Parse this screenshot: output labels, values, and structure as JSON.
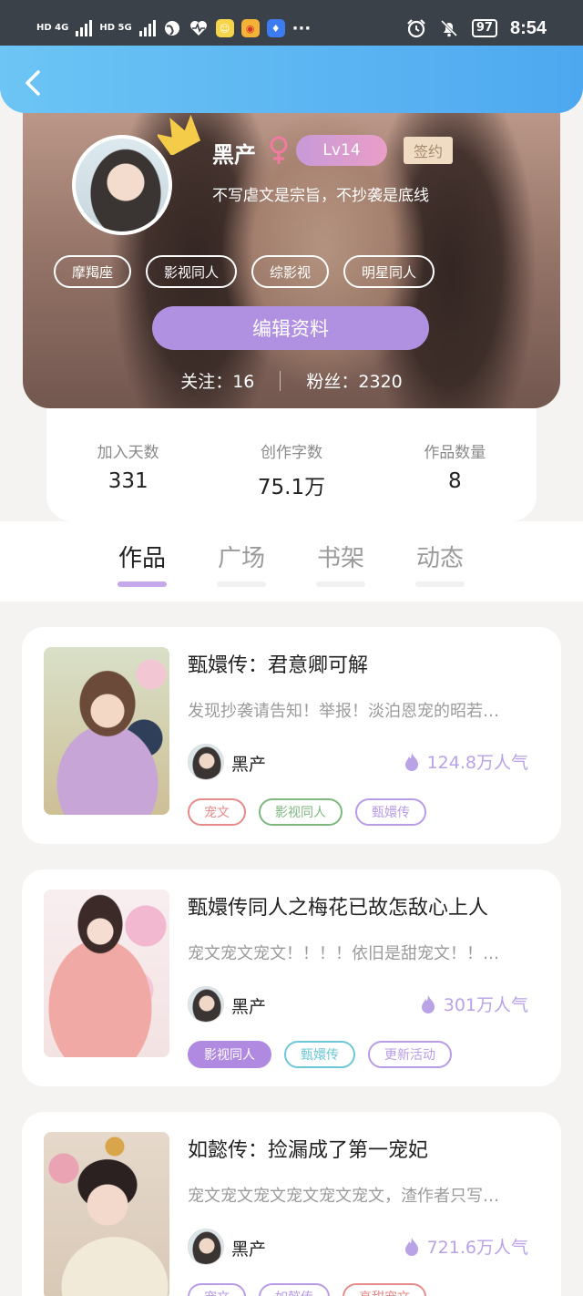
{
  "status_bar": {
    "network_1": "HD 4G",
    "network_2": "HD 5G",
    "battery": "97",
    "time": "8:54",
    "dots": "···"
  },
  "profile": {
    "username": "黑产",
    "level": "Lv14",
    "sign_badge": "签约",
    "motto": "不写虐文是宗旨，不抄袭是底线",
    "tags": [
      "摩羯座",
      "影视同人",
      "综影视",
      "明星同人"
    ],
    "edit_button": "编辑资料",
    "following_label": "关注：16",
    "followers_label": "粉丝：2320"
  },
  "stats": [
    {
      "label": "加入天数",
      "value": "331"
    },
    {
      "label": "创作字数",
      "value": "75.1万"
    },
    {
      "label": "作品数量",
      "value": "8"
    }
  ],
  "tabs": [
    "作品",
    "广场",
    "书架",
    "动态"
  ],
  "active_tab": "作品",
  "books": [
    {
      "title": "甄嬛传：君意卿可解",
      "desc": "发现抄袭请告知！举报！淡泊恩宠的昭若…",
      "author": "黑产",
      "heat": "124.8万人气",
      "tags": [
        {
          "label": "宠文",
          "color": "#e58b8b"
        },
        {
          "label": "影视同人",
          "color": "#7fb77e"
        },
        {
          "label": "甄嬛传",
          "color": "#b89ce6"
        }
      ]
    },
    {
      "title": "甄嬛传同人之梅花已故怎敌心上人",
      "desc": "宠文宠文宠文！！！！依旧是甜宠文！！…",
      "author": "黑产",
      "heat": "301万人气",
      "tags": [
        {
          "label": "影视同人",
          "color": "#b089e0",
          "filled": true
        },
        {
          "label": "甄嬛传",
          "color": "#6cc7d6"
        },
        {
          "label": "更新活动",
          "color": "#b89ce6"
        }
      ]
    },
    {
      "title": "如懿传：捡漏成了第一宠妃",
      "desc": "宠文宠文宠文宠文宠文宠文，渣作者只写…",
      "author": "黑产",
      "heat": "721.6万人气",
      "tags": [
        {
          "label": "宠文",
          "color": "#b89ce6"
        },
        {
          "label": "如懿传",
          "color": "#b89ce6"
        },
        {
          "label": "高甜宠文",
          "color": "#e58b8b"
        }
      ]
    }
  ],
  "colors": {
    "accent": "#b090e0",
    "header_blue": "#4ea8f0",
    "heat": "#b9a2e6"
  }
}
